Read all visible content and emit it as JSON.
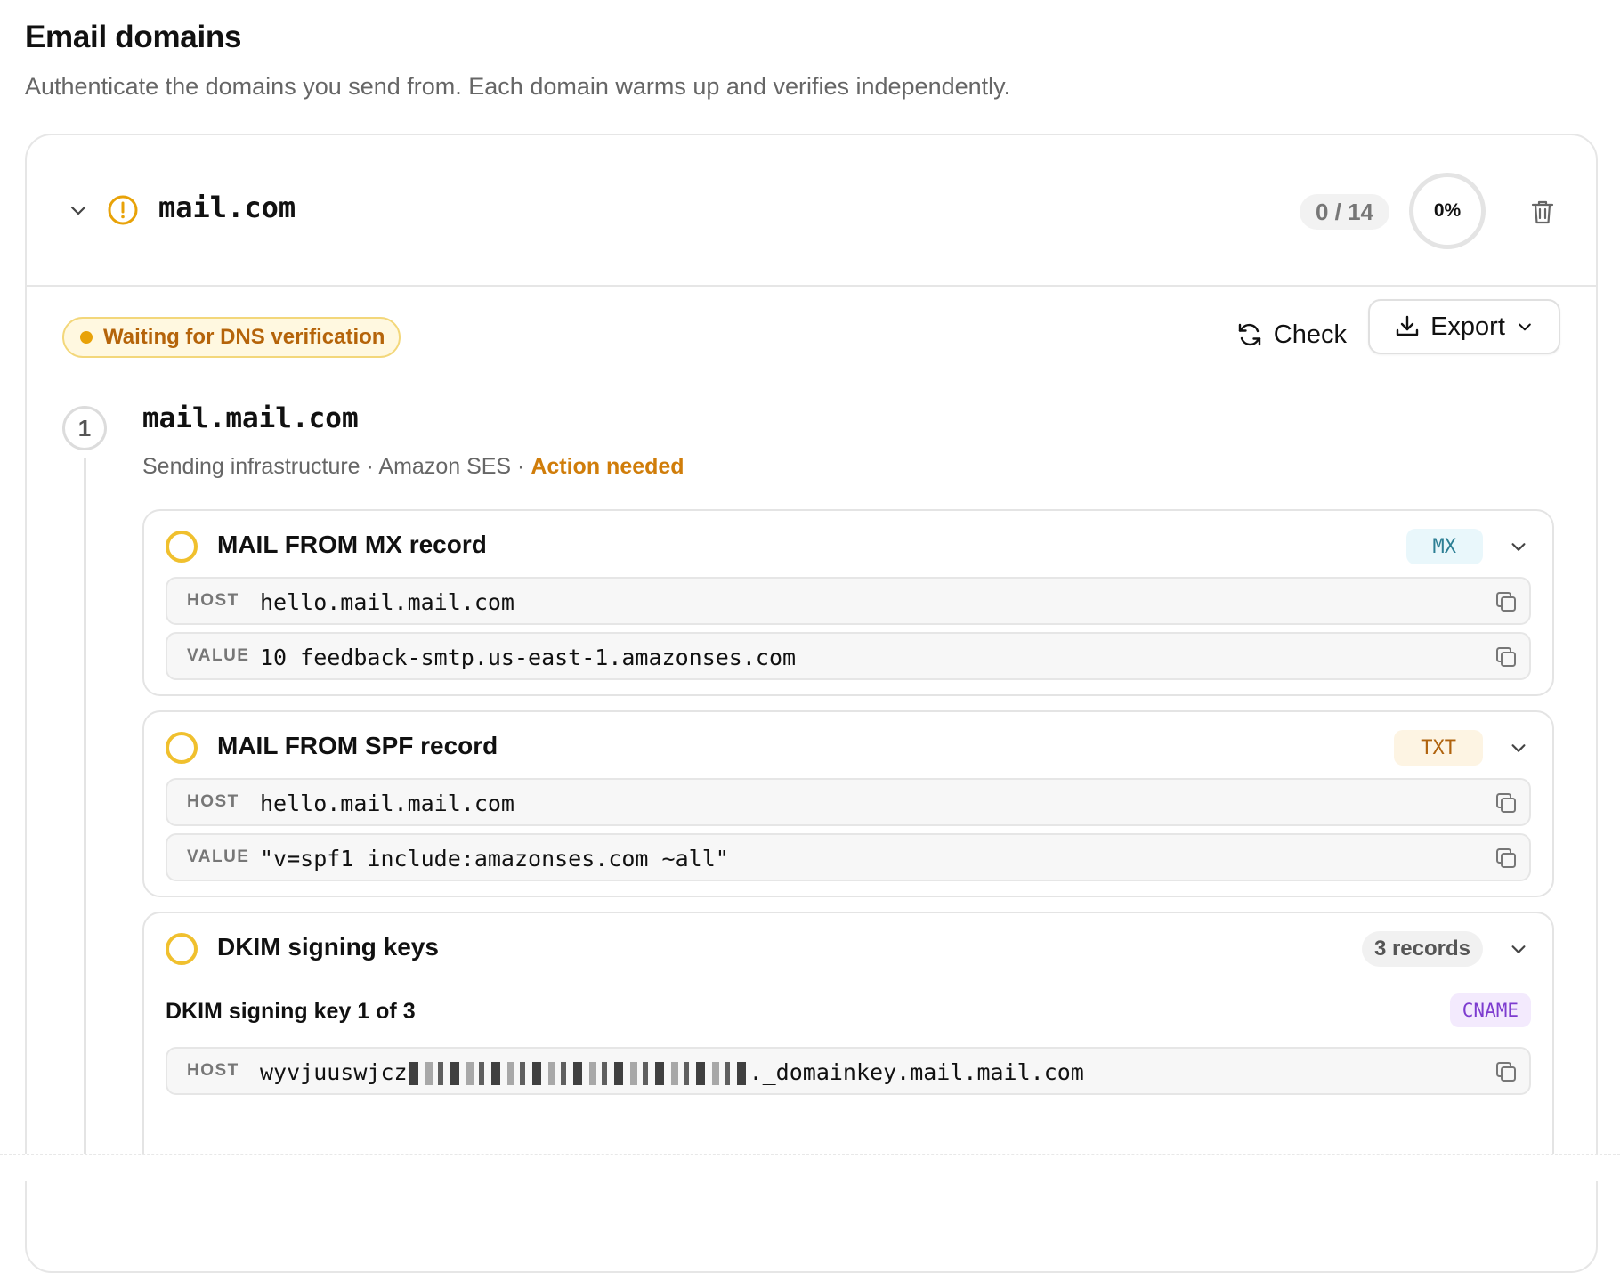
{
  "page": {
    "title": "Email domains",
    "subtitle": "Authenticate the domains you send from. Each domain warms up and verifies independently."
  },
  "domain": {
    "name": "mail.com",
    "progress_count": "0 / 14",
    "progress_percent_label": "0%",
    "progress_fraction": 0,
    "status": "Waiting for DNS verification",
    "check_label": "Check",
    "export_label": "Export",
    "colors": {
      "warning": "#e8a208",
      "status_text": "#b5640a",
      "action_needed": "#d07d0a"
    }
  },
  "step": {
    "number": "1",
    "title": "mail.mail.com",
    "meta_prefix": "Sending infrastructure · Amazon SES · ",
    "meta_action": "Action needed"
  },
  "records": [
    {
      "title": "MAIL FROM MX record",
      "type": "MX",
      "host_label": "HOST",
      "host": "hello.mail.mail.com",
      "value_label": "VALUE",
      "value": "10 feedback-smtp.us-east-1.amazonses.com"
    },
    {
      "title": "MAIL FROM SPF record",
      "type": "TXT",
      "host_label": "HOST",
      "host": "hello.mail.mail.com",
      "value_label": "VALUE",
      "value": "\"v=spf1 include:amazonses.com ~all\""
    },
    {
      "title": "DKIM signing keys",
      "type_count": "3 records",
      "sub_title": "DKIM signing key 1 of 3",
      "sub_type": "CNAME",
      "host_label": "HOST",
      "host_prefix": "wyvjuuswjcz",
      "host_suffix": "._domainkey.mail.mail.com"
    }
  ],
  "icons": {
    "collapse": "chevron-down-icon",
    "warning": "warning-circle-icon",
    "delete": "trash-icon",
    "refresh": "refresh-icon",
    "download": "download-icon",
    "copy": "copy-icon"
  }
}
